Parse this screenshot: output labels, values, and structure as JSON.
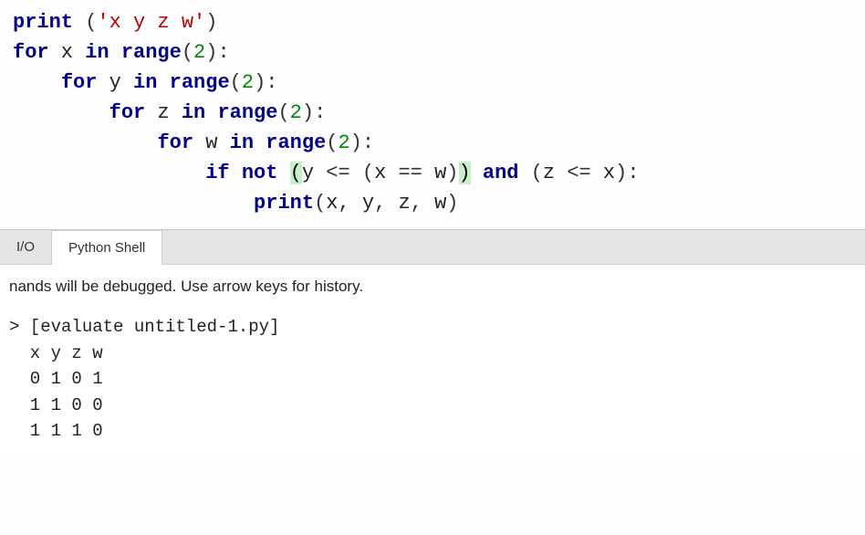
{
  "code": {
    "lines": [
      {
        "indent": 0,
        "tokens": [
          {
            "t": "fn",
            "v": "print"
          },
          {
            "t": "var",
            "v": " "
          },
          {
            "t": "op",
            "v": "("
          },
          {
            "t": "str",
            "v": "'x y z w'"
          },
          {
            "t": "op",
            "v": ")"
          }
        ]
      },
      {
        "indent": 0,
        "tokens": [
          {
            "t": "kw",
            "v": "for"
          },
          {
            "t": "var",
            "v": " x "
          },
          {
            "t": "kw",
            "v": "in"
          },
          {
            "t": "var",
            "v": " "
          },
          {
            "t": "fn",
            "v": "range"
          },
          {
            "t": "op",
            "v": "("
          },
          {
            "t": "num",
            "v": "2"
          },
          {
            "t": "op",
            "v": ")"
          },
          {
            "t": "op",
            "v": ":"
          }
        ]
      },
      {
        "indent": 1,
        "tokens": [
          {
            "t": "kw",
            "v": "for"
          },
          {
            "t": "var",
            "v": " y "
          },
          {
            "t": "kw",
            "v": "in"
          },
          {
            "t": "var",
            "v": " "
          },
          {
            "t": "fn",
            "v": "range"
          },
          {
            "t": "op",
            "v": "("
          },
          {
            "t": "num",
            "v": "2"
          },
          {
            "t": "op",
            "v": ")"
          },
          {
            "t": "op",
            "v": ":"
          }
        ]
      },
      {
        "indent": 2,
        "tokens": [
          {
            "t": "kw",
            "v": "for"
          },
          {
            "t": "var",
            "v": " z "
          },
          {
            "t": "kw",
            "v": "in"
          },
          {
            "t": "var",
            "v": " "
          },
          {
            "t": "fn",
            "v": "range"
          },
          {
            "t": "op",
            "v": "("
          },
          {
            "t": "num",
            "v": "2"
          },
          {
            "t": "op",
            "v": ")"
          },
          {
            "t": "op",
            "v": ":"
          }
        ]
      },
      {
        "indent": 3,
        "tokens": [
          {
            "t": "kw",
            "v": "for"
          },
          {
            "t": "var",
            "v": " w "
          },
          {
            "t": "kw",
            "v": "in"
          },
          {
            "t": "var",
            "v": " "
          },
          {
            "t": "fn",
            "v": "range"
          },
          {
            "t": "op",
            "v": "("
          },
          {
            "t": "num",
            "v": "2"
          },
          {
            "t": "op",
            "v": ")"
          },
          {
            "t": "op",
            "v": ":"
          }
        ]
      },
      {
        "indent": 4,
        "tokens": [
          {
            "t": "kw",
            "v": "if"
          },
          {
            "t": "var",
            "v": " "
          },
          {
            "t": "kw",
            "v": "not"
          },
          {
            "t": "var",
            "v": " "
          },
          {
            "t": "paren-hl",
            "v": "("
          },
          {
            "t": "var",
            "v": "y "
          },
          {
            "t": "op",
            "v": "<="
          },
          {
            "t": "var",
            "v": " "
          },
          {
            "t": "op",
            "v": "("
          },
          {
            "t": "var",
            "v": "x "
          },
          {
            "t": "op",
            "v": "=="
          },
          {
            "t": "var",
            "v": " w"
          },
          {
            "t": "op",
            "v": ")"
          },
          {
            "t": "paren-hl",
            "v": ")"
          },
          {
            "t": "var",
            "v": " "
          },
          {
            "t": "kw",
            "v": "and"
          },
          {
            "t": "var",
            "v": " "
          },
          {
            "t": "op",
            "v": "("
          },
          {
            "t": "var",
            "v": "z "
          },
          {
            "t": "op",
            "v": "<="
          },
          {
            "t": "var",
            "v": " x"
          },
          {
            "t": "op",
            "v": ")"
          },
          {
            "t": "op",
            "v": ":"
          }
        ]
      },
      {
        "indent": 5,
        "tokens": [
          {
            "t": "fn",
            "v": "print"
          },
          {
            "t": "op",
            "v": "("
          },
          {
            "t": "var",
            "v": "x"
          },
          {
            "t": "op",
            "v": ","
          },
          {
            "t": "var",
            "v": " y"
          },
          {
            "t": "op",
            "v": ","
          },
          {
            "t": "var",
            "v": " z"
          },
          {
            "t": "op",
            "v": ","
          },
          {
            "t": "var",
            "v": " w"
          },
          {
            "t": "op",
            "v": ")"
          }
        ]
      }
    ]
  },
  "tabs": {
    "io": "I/O",
    "shell": "Python Shell"
  },
  "shell": {
    "message": "nands will be debugged.  Use arrow keys for history.",
    "prompt": ">",
    "eval_line": "[evaluate untitled-1.py]",
    "output_lines": [
      "x y z w",
      "0 1 0 1",
      "1 1 0 0",
      "1 1 1 0"
    ]
  }
}
